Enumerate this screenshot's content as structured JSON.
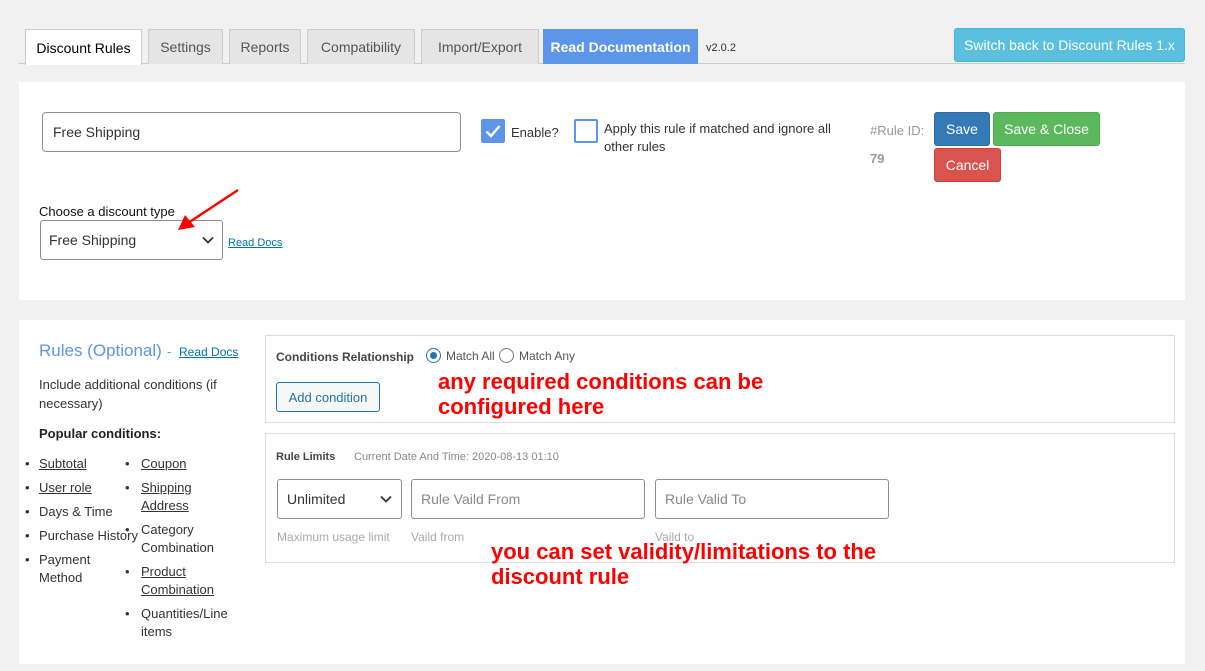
{
  "tabs": [
    "Discount Rules",
    "Settings",
    "Reports",
    "Compatibility",
    "Import/Export",
    "Read Documentation"
  ],
  "version": "v2.0.2",
  "switch_button": "Switch back to Discount Rules 1.x",
  "rule": {
    "title_value": "Free Shipping",
    "enable_label": "Enable?",
    "apply_label": "Apply this rule if matched and ignore all other rules",
    "rule_id_label": "#Rule ID:",
    "rule_id": "79",
    "save": "Save",
    "save_close": "Save & Close",
    "cancel": "Cancel"
  },
  "discount_type": {
    "label": "Choose a discount type",
    "selected": "Free Shipping",
    "read_docs": "Read Docs"
  },
  "rules_section": {
    "title": "Rules (Optional)",
    "dash": "-",
    "read_docs": "Read Docs",
    "include_text": "Include additional conditions (if necessary)",
    "popular_label": "Popular conditions:",
    "col1": [
      "Subtotal",
      "User role",
      "Days & Time",
      "Purchase History",
      "Payment Method"
    ],
    "col2": [
      "Coupon",
      "Shipping Address",
      "Category Combination",
      "Product Combination",
      "Quantities/Line items"
    ]
  },
  "conditions": {
    "relationship_label": "Conditions Relationship",
    "match_all": "Match All",
    "match_any": "Match Any",
    "add_condition": "Add condition"
  },
  "limits": {
    "label": "Rule Limits",
    "current_date": "Current Date And Time: 2020-08-13 01:10",
    "usage_selected": "Unlimited",
    "valid_from_placeholder": "Rule Vaild From",
    "valid_to_placeholder": "Rule Valid To",
    "usage_hint": "Maximum usage limit",
    "from_hint": "Vaild from",
    "to_hint": "Vaild to"
  },
  "annotations": {
    "conditions_note_1": "any required conditions can be",
    "conditions_note_2": "configured here",
    "limits_note_1": "you can set validity/limitations to the",
    "limits_note_2": "discount rule"
  },
  "colors": {
    "accent": "#5d95e8",
    "save": "#337ab7",
    "save_close": "#5cb85c",
    "cancel": "#d9534f",
    "switch": "#5bc0de",
    "annotation": "#ff0000"
  }
}
